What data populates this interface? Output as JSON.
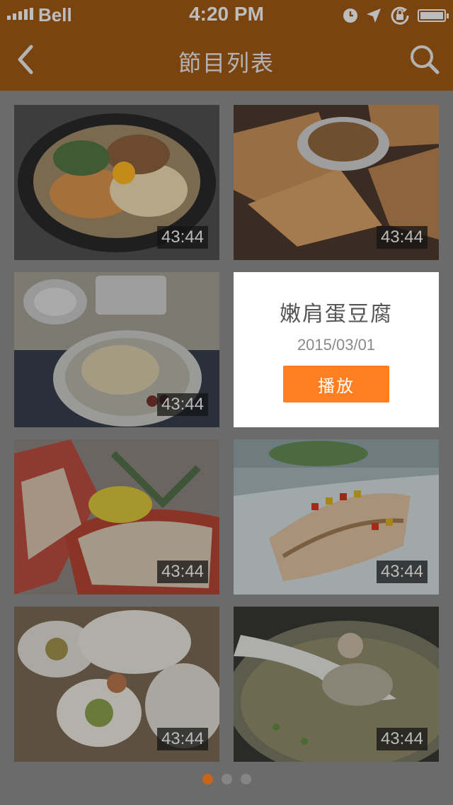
{
  "status_bar": {
    "carrier": "Bell",
    "time": "4:20 PM",
    "icons": [
      "signal-icon",
      "clock-icon",
      "location-icon",
      "rotation-lock-icon",
      "battery-icon"
    ]
  },
  "nav": {
    "title": "節目列表",
    "back_icon": "chevron-left-icon",
    "search_icon": "search-icon"
  },
  "items": [
    {
      "dish": "bibimbap",
      "duration": "43:44"
    },
    {
      "dish": "seafood-pancake",
      "duration": "43:44"
    },
    {
      "dish": "samgyetang",
      "duration": "43:44"
    },
    {
      "dish": "popup"
    },
    {
      "dish": "lobster",
      "duration": "43:44"
    },
    {
      "dish": "grilled-fish",
      "duration": "43:44"
    },
    {
      "dish": "spring-rolls",
      "duration": "43:44"
    },
    {
      "dish": "bone-soup",
      "duration": "43:44"
    }
  ],
  "popup": {
    "title": "嫩肩蛋豆腐",
    "date": "2015/03/01",
    "play_label": "播放"
  },
  "pagination": {
    "pages": 3,
    "current": 1
  },
  "colors": {
    "accent": "#ff7f21",
    "nav_bg": "#7a4410",
    "overlay_bg": "#6b6b6b"
  }
}
